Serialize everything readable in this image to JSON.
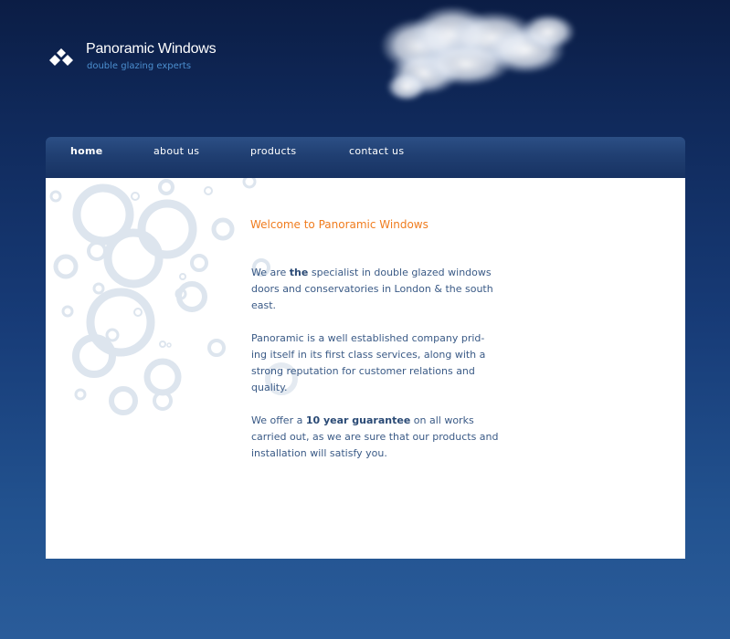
{
  "site": {
    "title": "Panoramic Windows",
    "tagline": "double glazing experts"
  },
  "nav": {
    "items": [
      {
        "label": "home",
        "active": true
      },
      {
        "label": "about us",
        "active": false
      },
      {
        "label": "products",
        "active": false
      },
      {
        "label": "contact us",
        "active": false
      }
    ]
  },
  "content": {
    "heading": "Welcome to Panoramic Windows",
    "p1": {
      "pre": "We are ",
      "bold": "the",
      "post": " specialist in double glazed windows doors and conservatories in London & the south east."
    },
    "p2": {
      "line1": "Panoramic is a well established company prid-",
      "line2": "ing itself in its first class services, along with a strong reputation for customer relations and quality."
    },
    "p3": {
      "pre": "We offer a ",
      "bold": "10 year guarantee",
      "post": " on all works carried out, as we are sure that our products and installation will satisfy you."
    }
  },
  "colors": {
    "heading_accent": "#f07c1e",
    "body_text": "#3a5a86",
    "tagline": "#4c8fd0",
    "bubbles": "#dde5ee"
  },
  "icons": {
    "logo": "diamond-logo-icon",
    "cloud": "cloud-graphic",
    "bubbles": "bubbles-decoration"
  }
}
